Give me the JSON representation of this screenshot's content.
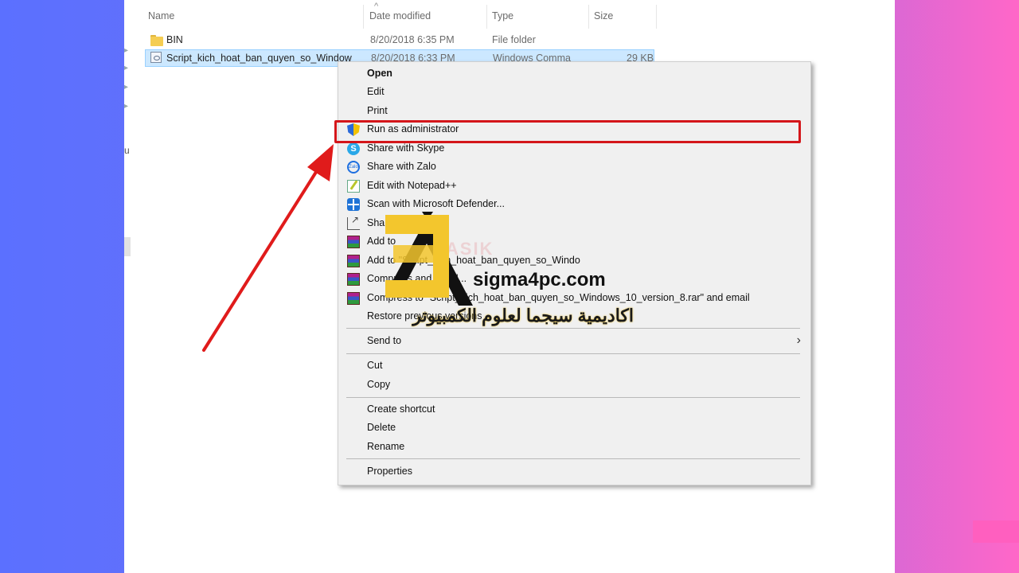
{
  "explorer": {
    "columns": [
      {
        "label": "Name"
      },
      {
        "label": "Date modified"
      },
      {
        "label": "Type"
      },
      {
        "label": "Size"
      }
    ],
    "sort_indicator": "^",
    "files": [
      {
        "name": "BIN",
        "date": "8/20/2018 6:35 PM",
        "type": "File folder",
        "size": "",
        "icon": "folder-icon",
        "selected": false
      },
      {
        "name": "Script_kich_hoat_ban_quyen_so_Window",
        "date": "8/20/2018 6:33 PM",
        "type": "Windows Comma",
        "size": "29 KB",
        "icon": "script-file-icon",
        "selected": true
      }
    ],
    "left_fragment": "u"
  },
  "context_menu": {
    "items": [
      {
        "label": "Open",
        "bold": true
      },
      {
        "label": "Edit"
      },
      {
        "label": "Print"
      },
      {
        "label": "Run as administrator",
        "icon": "uac-shield-icon",
        "highlighted": true
      },
      {
        "label": "Share with Skype",
        "icon": "skype-icon"
      },
      {
        "label": "Share with Zalo",
        "icon": "zalo-icon"
      },
      {
        "label": "Edit with Notepad++",
        "icon": "notepad-plus-plus-icon"
      },
      {
        "label": "Scan with Microsoft Defender...",
        "icon": "defender-icon"
      },
      {
        "label": "Share",
        "icon": "share-icon"
      },
      {
        "label": "Add to",
        "icon": "winrar-icon"
      },
      {
        "label": "Add to \"Script_kich_hoat_ban_quyen_so_Windo",
        "icon": "winrar-icon"
      },
      {
        "label": "Compress and email...",
        "icon": "winrar-icon"
      },
      {
        "label": "Compress to \"Script_kich_hoat_ban_quyen_so_Windows_10_version_8.rar\" and email",
        "icon": "winrar-icon"
      },
      {
        "label": "Restore previous versions"
      },
      {
        "label": "Send to",
        "submenu": true
      },
      {
        "label": "Cut"
      },
      {
        "label": "Copy"
      },
      {
        "label": "Create shortcut"
      },
      {
        "label": "Delete"
      },
      {
        "label": "Rename"
      },
      {
        "label": "Properties"
      }
    ],
    "submenu_chevron": "›"
  },
  "annotation": {
    "highlight_color": "#d4161a",
    "arrow_color": "#e01b1b"
  },
  "watermark": {
    "logo_letter": "ک",
    "site": "sigma4pc.com",
    "arabic": "اكاديمية سيجما لعلوم الكمبيوتر",
    "faded": "KASIK",
    "accent_color": "#f3c62d"
  },
  "colors": {
    "selection": "#cce8ff",
    "menu_bg": "#f0f0f0"
  }
}
